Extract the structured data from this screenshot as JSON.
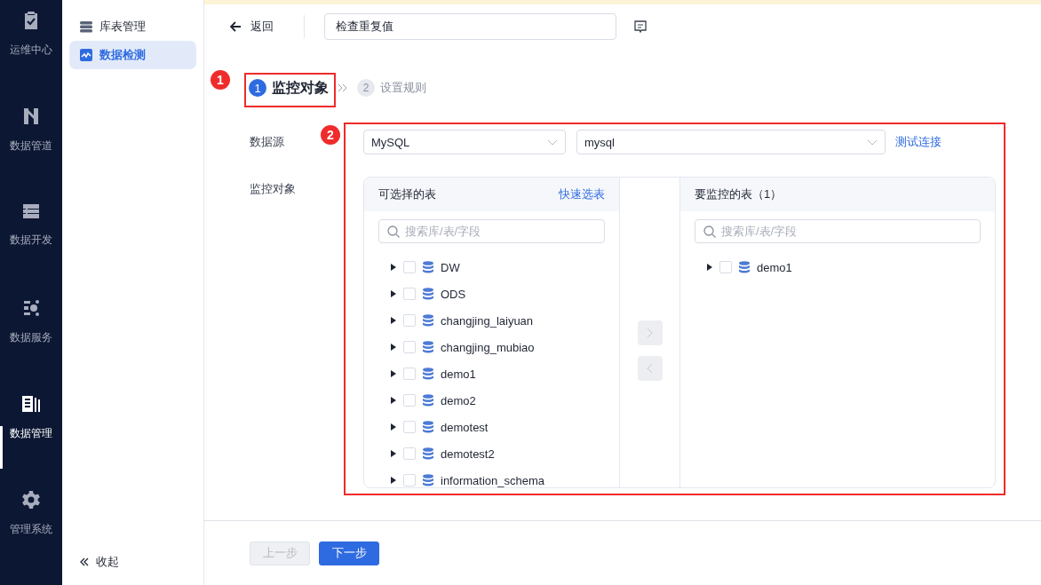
{
  "nav": {
    "items": [
      {
        "kind": "ops",
        "label": "运维中心",
        "selected": false
      },
      {
        "kind": "pipeline",
        "label": "数据管道",
        "selected": false
      },
      {
        "kind": "develop",
        "label": "数据开发",
        "selected": false
      },
      {
        "kind": "service",
        "label": "数据服务",
        "selected": false
      },
      {
        "kind": "manage",
        "label": "数据管理",
        "selected": true
      },
      {
        "kind": "system",
        "label": "管理系统",
        "selected": false
      }
    ]
  },
  "sidebar": {
    "items": [
      {
        "kind": "table",
        "label": "库表管理",
        "selected": false
      },
      {
        "kind": "monitor",
        "label": "数据检测",
        "selected": true
      }
    ],
    "collapse": "收起"
  },
  "header": {
    "back": "返回",
    "name_value": "检查重复值"
  },
  "steps": [
    {
      "number": "1",
      "label": "监控对象",
      "selected": true
    },
    {
      "number": "2",
      "label": "设置规则",
      "selected": false
    }
  ],
  "form": {
    "source_label": "数据源",
    "source_type": "MySQL",
    "source_name": "mysql",
    "test_link": "测试连接",
    "target_label": "监控对象"
  },
  "transfer": {
    "left": {
      "title": "可选择的表",
      "action": "快速选表",
      "placeholder": "搜索库/表/字段",
      "items": [
        {
          "label": "DW",
          "checked": false,
          "expanded": false
        },
        {
          "label": "ODS",
          "checked": false,
          "expanded": false
        },
        {
          "label": "changjing_laiyuan",
          "checked": false,
          "expanded": false
        },
        {
          "label": "changjing_mubiao",
          "checked": false,
          "expanded": false
        },
        {
          "label": "demo1",
          "checked": false,
          "expanded": false
        },
        {
          "label": "demo2",
          "checked": false,
          "expanded": false
        },
        {
          "label": "demotest",
          "checked": false,
          "expanded": false
        },
        {
          "label": "demotest2",
          "checked": false,
          "expanded": false
        },
        {
          "label": "information_schema",
          "checked": false,
          "expanded": false
        }
      ]
    },
    "buttons": [
      {
        "kind": "right",
        "disabled": true
      },
      {
        "kind": "left",
        "disabled": true
      }
    ],
    "right": {
      "title": "要监控的表（1）",
      "placeholder": "搜索库/表/字段",
      "items": [
        {
          "label": "demo1",
          "checked": false,
          "expanded": false
        }
      ]
    }
  },
  "footer": [
    {
      "label": "上一步",
      "disabled": true
    },
    {
      "label": "下一步",
      "disabled": false
    }
  ],
  "annotations": [
    {
      "label": "1"
    },
    {
      "label": "2"
    }
  ]
}
